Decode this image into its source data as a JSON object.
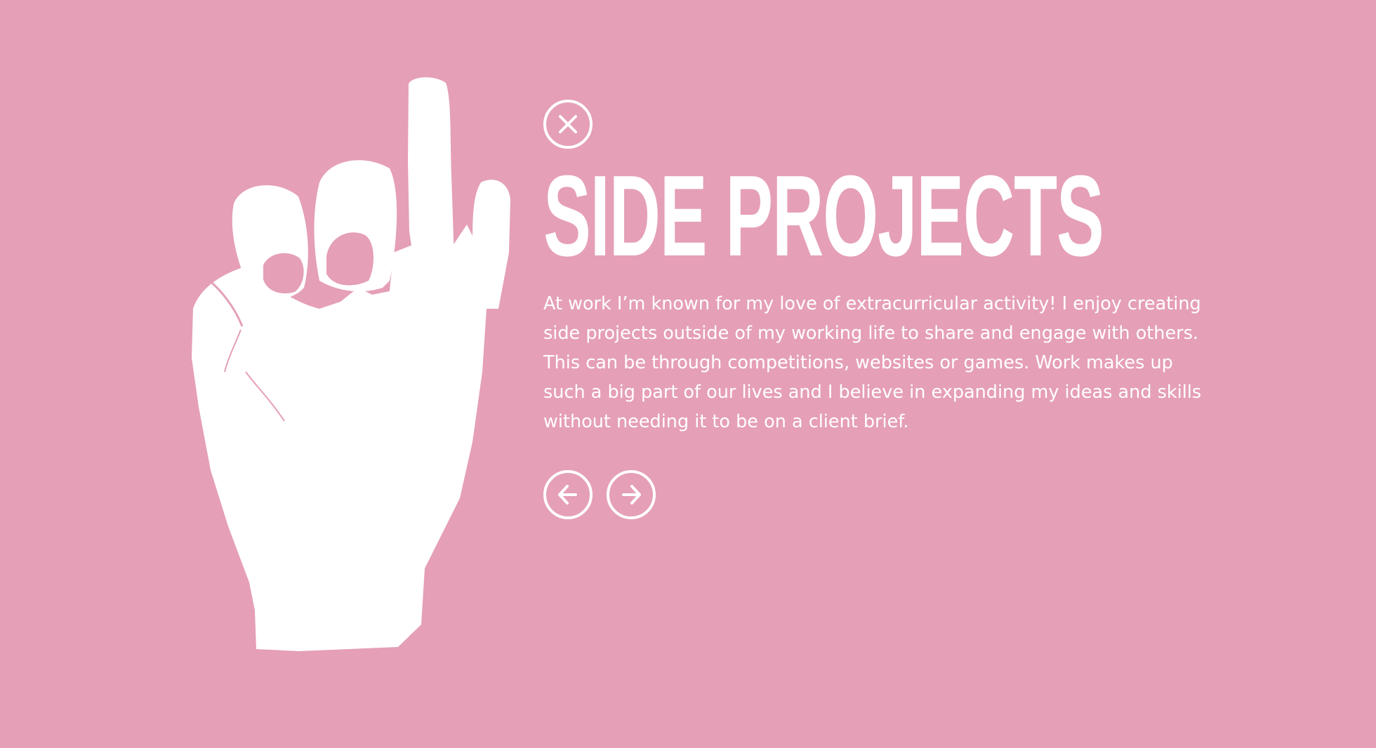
{
  "section": {
    "title": "SIDE PROJECTS",
    "body": "At work I’m known for my love of extracurricular activity! I enjoy creating side projects outside of my working life to share and engage with others. This can be through competitions, websites or games. Work makes up such a big part of our lives and I believe in expanding my ideas and skills without needing it to be on a client brief."
  },
  "icons": {
    "close": "close-icon",
    "previous": "arrow-left-icon",
    "next": "arrow-right-icon",
    "illustration": "hand-illustration"
  },
  "colors": {
    "background": "#e59fb7",
    "foreground": "#ffffff"
  }
}
